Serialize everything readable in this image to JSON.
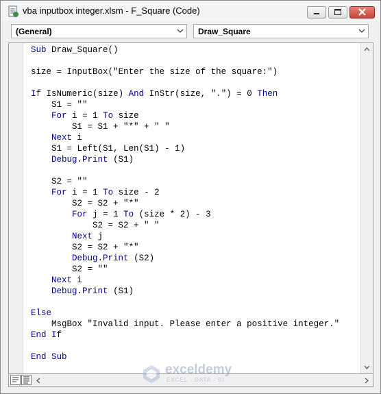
{
  "window": {
    "title": "vba inputbox integer.xlsm - F_Square (Code)"
  },
  "toolbar": {
    "object_combo": "(General)",
    "procedure_combo": "Draw_Square"
  },
  "code": {
    "lines": [
      "Sub Draw_Square()",
      "",
      "size = InputBox(\"Enter the size of the square:\")",
      "",
      "If IsNumeric(size) And InStr(size, \".\") = 0 Then",
      "    S1 = \"\"",
      "    For i = 1 To size",
      "        S1 = S1 + \"*\" + \" \"",
      "    Next i",
      "    S1 = Left(S1, Len(S1) - 1)",
      "    Debug.Print (S1)",
      "",
      "    S2 = \"\"",
      "    For i = 1 To size - 2",
      "        S2 = S2 + \"*\"",
      "        For j = 1 To (size * 2) - 3",
      "            S2 = S2 + \" \"",
      "        Next j",
      "        S2 = S2 + \"*\"",
      "        Debug.Print (S2)",
      "        S2 = \"\"",
      "    Next i",
      "    Debug.Print (S1)",
      "",
      "Else",
      "    MsgBox \"Invalid input. Please enter a positive integer.\"",
      "End If",
      "",
      "End Sub"
    ],
    "keywords": [
      "Sub",
      "If",
      "And",
      "Then",
      "For",
      "To",
      "Next",
      "Debug",
      "Print",
      "Else",
      "End"
    ],
    "keyword_color": "#00008b"
  },
  "icons": {
    "app": "vba-module-icon",
    "minimize": "minimize-icon",
    "maximize": "maximize-icon",
    "close": "close-icon"
  },
  "watermark": {
    "name": "exceldemy",
    "tagline": "EXCEL · DATA · BI"
  }
}
